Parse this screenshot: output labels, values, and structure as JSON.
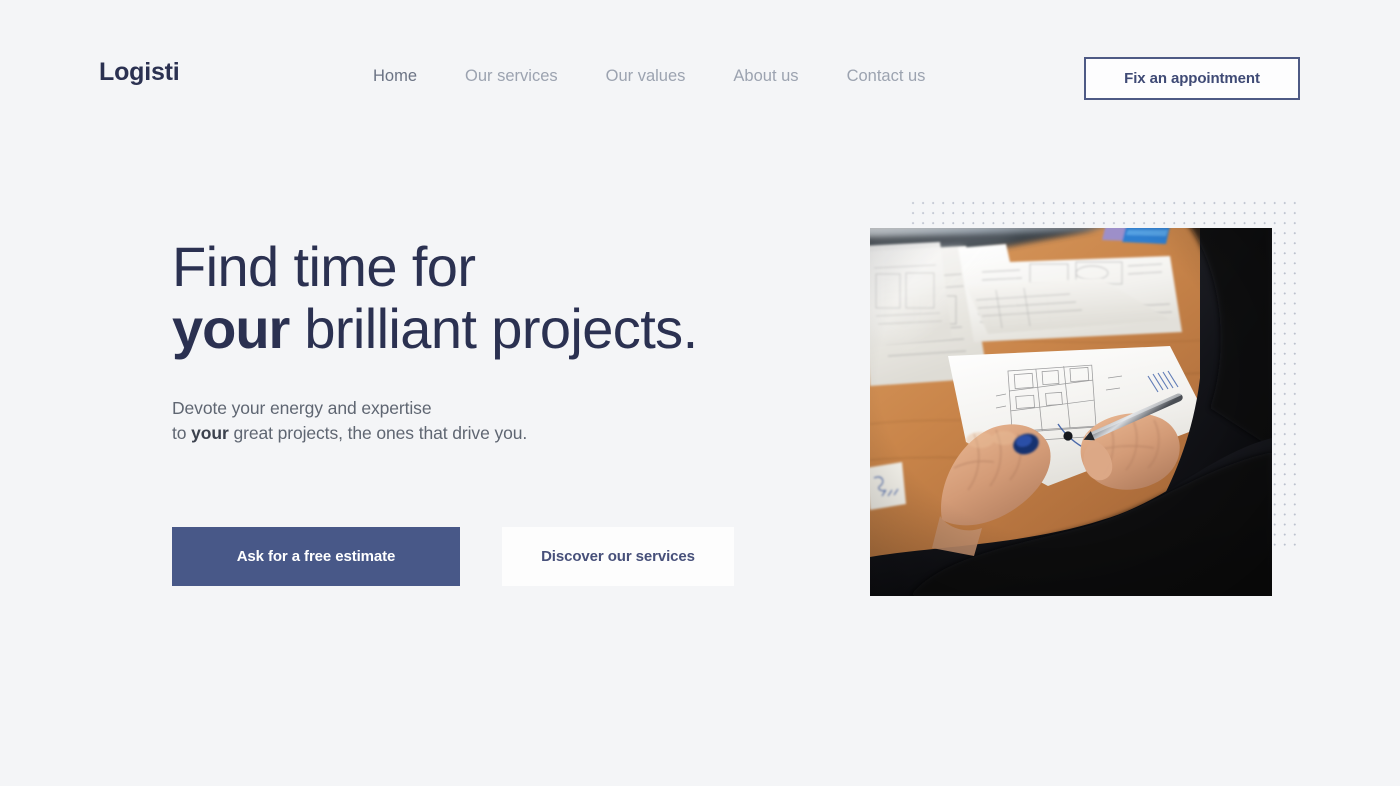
{
  "brand": {
    "name": "Logisti"
  },
  "nav": {
    "items": [
      {
        "label": "Home",
        "active": true
      },
      {
        "label": "Our services",
        "active": false
      },
      {
        "label": "Our values",
        "active": false
      },
      {
        "label": "About us",
        "active": false
      },
      {
        "label": "Contact us",
        "active": false
      }
    ],
    "cta_label": "Fix an appointment"
  },
  "hero": {
    "title_line1": "Find time for",
    "title_line2_em": "your",
    "title_line2_rest": " brilliant projects.",
    "sub_line1": "Devote your energy and expertise",
    "sub_line2_prefix": "to ",
    "sub_line2_em": "your",
    "sub_line2_rest": " great projects, the ones that drive you.",
    "primary_cta": "Ask for a free estimate",
    "secondary_cta": "Discover our services",
    "image_alt": "Architect drawing on building blueprints at a wooden desk"
  },
  "colors": {
    "page_background": "#f4f5f7",
    "brand_navy": "#2b3151",
    "primary_button": "#485888",
    "secondary_button": "#fdfdfd",
    "nav_inactive": "#9ca3b0",
    "nav_active": "#6b7384",
    "outline_button_border": "#4e5a85",
    "dot_pattern": "#b9bfcc",
    "body_text": "#5f6672"
  }
}
